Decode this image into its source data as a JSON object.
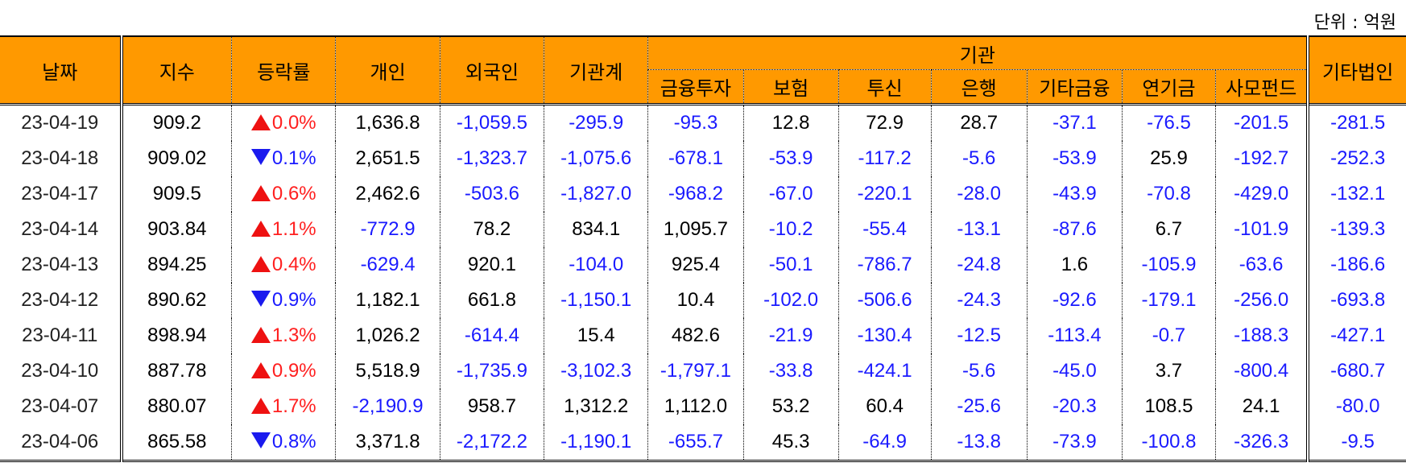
{
  "unit_label": "단위 : 억원",
  "headers": {
    "date": "날짜",
    "index": "지수",
    "change": "등락률",
    "individual": "개인",
    "foreign": "외국인",
    "institution_total": "기관계",
    "institution_group": "기관",
    "institution_sub": [
      "금융투자",
      "보험",
      "투신",
      "은행",
      "기타금융",
      "연기금",
      "사모펀드"
    ],
    "other_corp": "기타법인"
  },
  "colors": {
    "header_bg": "#ff9900",
    "negative": "#1a1aff",
    "up_arrow": "#ee1111",
    "down_arrow": "#1a1aee"
  },
  "rows": [
    {
      "date": "23-04-19",
      "index": "909.2",
      "dir": "up",
      "change": "0.0%",
      "cells": [
        "1,636.8",
        "-1,059.5",
        "-295.9",
        "-95.3",
        "12.8",
        "72.9",
        "28.7",
        "-37.1",
        "-76.5",
        "-201.5",
        "-281.5"
      ]
    },
    {
      "date": "23-04-18",
      "index": "909.02",
      "dir": "down",
      "change": "0.1%",
      "cells": [
        "2,651.5",
        "-1,323.7",
        "-1,075.6",
        "-678.1",
        "-53.9",
        "-117.2",
        "-5.6",
        "-53.9",
        "25.9",
        "-192.7",
        "-252.3"
      ]
    },
    {
      "date": "23-04-17",
      "index": "909.5",
      "dir": "up",
      "change": "0.6%",
      "cells": [
        "2,462.6",
        "-503.6",
        "-1,827.0",
        "-968.2",
        "-67.0",
        "-220.1",
        "-28.0",
        "-43.9",
        "-70.8",
        "-429.0",
        "-132.1"
      ]
    },
    {
      "date": "23-04-14",
      "index": "903.84",
      "dir": "up",
      "change": "1.1%",
      "cells": [
        "-772.9",
        "78.2",
        "834.1",
        "1,095.7",
        "-10.2",
        "-55.4",
        "-13.1",
        "-87.6",
        "6.7",
        "-101.9",
        "-139.3"
      ]
    },
    {
      "date": "23-04-13",
      "index": "894.25",
      "dir": "up",
      "change": "0.4%",
      "cells": [
        "-629.4",
        "920.1",
        "-104.0",
        "925.4",
        "-50.1",
        "-786.7",
        "-24.8",
        "1.6",
        "-105.9",
        "-63.6",
        "-186.6"
      ]
    },
    {
      "date": "23-04-12",
      "index": "890.62",
      "dir": "down",
      "change": "0.9%",
      "cells": [
        "1,182.1",
        "661.8",
        "-1,150.1",
        "10.4",
        "-102.0",
        "-506.6",
        "-24.3",
        "-92.6",
        "-179.1",
        "-256.0",
        "-693.8"
      ]
    },
    {
      "date": "23-04-11",
      "index": "898.94",
      "dir": "up",
      "change": "1.3%",
      "cells": [
        "1,026.2",
        "-614.4",
        "15.4",
        "482.6",
        "-21.9",
        "-130.4",
        "-12.5",
        "-113.4",
        "-0.7",
        "-188.3",
        "-427.1"
      ]
    },
    {
      "date": "23-04-10",
      "index": "887.78",
      "dir": "up",
      "change": "0.9%",
      "cells": [
        "5,518.9",
        "-1,735.9",
        "-3,102.3",
        "-1,797.1",
        "-33.8",
        "-424.1",
        "-5.6",
        "-45.0",
        "3.7",
        "-800.4",
        "-680.7"
      ]
    },
    {
      "date": "23-04-07",
      "index": "880.07",
      "dir": "up",
      "change": "1.7%",
      "cells": [
        "-2,190.9",
        "958.7",
        "1,312.2",
        "1,112.0",
        "53.2",
        "60.4",
        "-25.6",
        "-20.3",
        "108.5",
        "24.1",
        "-80.0"
      ]
    },
    {
      "date": "23-04-06",
      "index": "865.58",
      "dir": "down",
      "change": "0.8%",
      "cells": [
        "3,371.8",
        "-2,172.2",
        "-1,190.1",
        "-655.7",
        "45.3",
        "-64.9",
        "-13.8",
        "-73.9",
        "-100.8",
        "-326.3",
        "-9.5"
      ]
    }
  ]
}
